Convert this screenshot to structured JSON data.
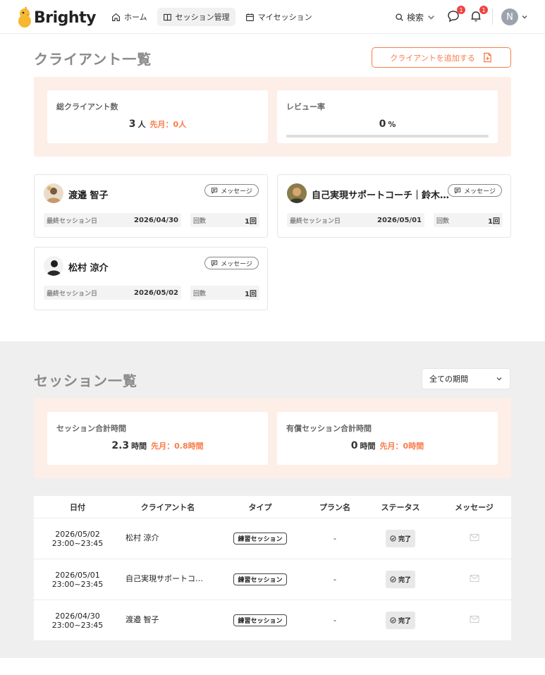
{
  "header": {
    "logo": "Brighty",
    "nav": [
      {
        "label": "ホーム",
        "icon": "home-icon"
      },
      {
        "label": "セッション管理",
        "icon": "book-icon",
        "active": true
      },
      {
        "label": "マイセッション",
        "icon": "calendar-icon"
      }
    ],
    "search_label": "検索",
    "chat_badge": "1",
    "bell_badge": "1",
    "user_initial": "N"
  },
  "clients": {
    "title": "クライアント一覧",
    "add_button": "クライアントを追加する",
    "stats": {
      "total_label": "総クライアント数",
      "total_value": "3",
      "total_unit": "人",
      "total_prev": "先月：0人",
      "review_label": "レビュー率",
      "review_value": "0",
      "review_unit": "%",
      "review_progress": 0
    },
    "message_label": "メッセージ",
    "last_session_label": "最終セッション日",
    "count_label": "回数",
    "cards": [
      {
        "name": "渡邉 智子",
        "last_session": "2026/04/30",
        "count": "1回"
      },
      {
        "name": "自己実現サポートコーチ｜鈴木…",
        "last_session": "2026/05/01",
        "count": "1回"
      },
      {
        "name": "松村 涼介",
        "last_session": "2026/05/02",
        "count": "1回"
      }
    ]
  },
  "sessions": {
    "title": "セッション一覧",
    "period": "全ての期間",
    "stats": {
      "total_label": "セッション合計時間",
      "total_value": "2.3",
      "total_unit": "時間",
      "total_prev": "先月：0.8時間",
      "paid_label": "有償セッション合計時間",
      "paid_value": "0",
      "paid_unit": "時間",
      "paid_prev": "先月：0時間"
    },
    "columns": [
      "日付",
      "クライアント名",
      "タイプ",
      "プラン名",
      "ステータス",
      "メッセージ"
    ],
    "rows": [
      {
        "date": "2026/05/02",
        "time": "23:00~23:45",
        "client": "松村 涼介",
        "type": "練習セッション",
        "plan": "-",
        "status": "完了"
      },
      {
        "date": "2026/05/01",
        "time": "23:00~23:45",
        "client": "自己実現サポートコ…",
        "type": "練習セッション",
        "plan": "-",
        "status": "完了"
      },
      {
        "date": "2026/04/30",
        "time": "23:00~23:45",
        "client": "渡邉 智子",
        "type": "練習セッション",
        "plan": "-",
        "status": "完了"
      }
    ]
  },
  "colors": {
    "accent": "#f97c4a",
    "stat_bg": "#fdeee7",
    "section_gray": "#efefef"
  }
}
